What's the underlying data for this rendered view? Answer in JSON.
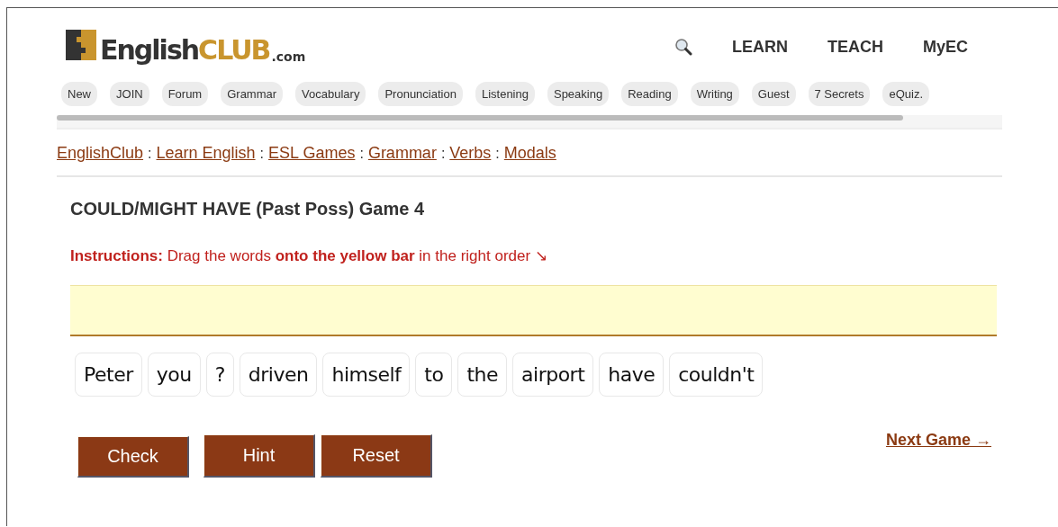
{
  "logo": {
    "english": "English",
    "club": "CLUB",
    "domain": ".com"
  },
  "top_nav": [
    "LEARN",
    "TEACH",
    "MyEC"
  ],
  "pills": [
    "New",
    "JOIN",
    "Forum",
    "Grammar",
    "Vocabulary",
    "Pronunciation",
    "Listening",
    "Speaking",
    "Reading",
    "Writing",
    "Guest",
    "7 Secrets",
    "eQuiz."
  ],
  "breadcrumb": [
    "EnglishClub",
    "Learn English",
    "ESL Games",
    "Grammar",
    "Verbs",
    "Modals"
  ],
  "breadcrumb_separator": ":",
  "title": "COULD/MIGHT HAVE (Past Poss) Game 4",
  "instructions": "**Instructions:** Drag the words **onto the yellow bar** in the right order ↘",
  "words": [
    "Peter",
    "you",
    "?",
    "driven",
    "himself",
    "to",
    "the",
    "airport",
    "have",
    "couldn't"
  ],
  "buttons": [
    "Check",
    "Hint",
    "Reset"
  ],
  "next_link": "Next Game →"
}
